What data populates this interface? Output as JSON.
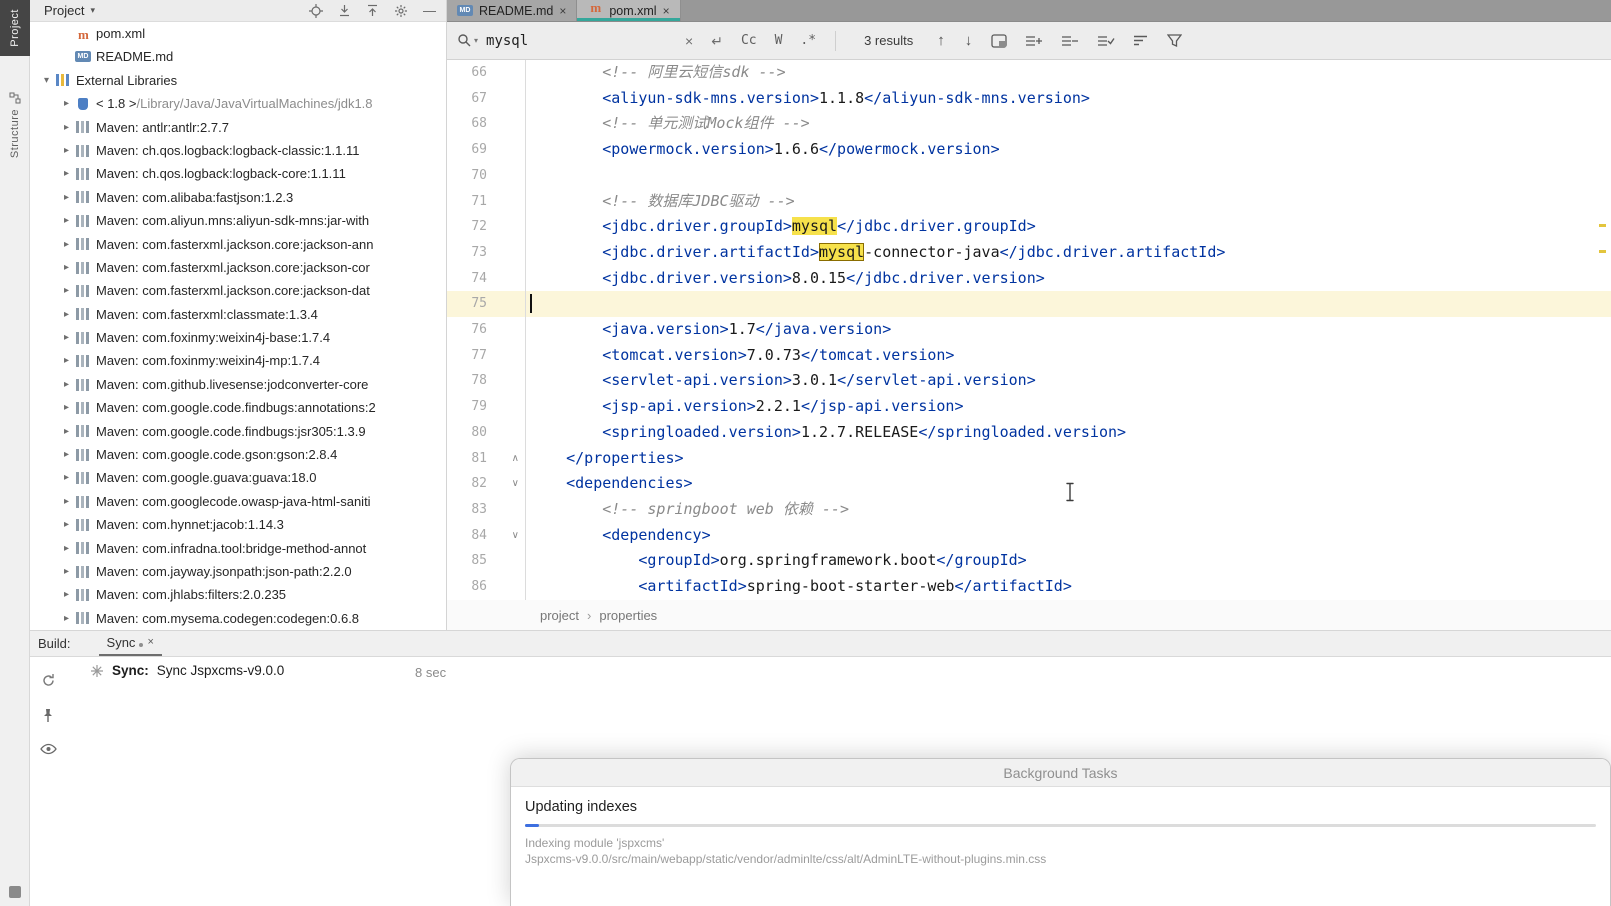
{
  "icons": {
    "close": "×",
    "chevron_down": "▾",
    "chevron_right": "▸",
    "arrow_up": "↑",
    "arrow_down": "↓",
    "enter_arrow": "↵",
    "breadcrumb_separator": "›",
    "minimize": "—",
    "fold_up": "∧",
    "fold_down": "∨"
  },
  "tool_stripe": {
    "project_label": "Project",
    "structure_label": "Structure"
  },
  "project_panel": {
    "title": "Project",
    "tree": [
      {
        "label": "pom.xml",
        "icon": "maven",
        "arrow": null,
        "indent": 1
      },
      {
        "label": "README.md",
        "icon": "md",
        "arrow": null,
        "indent": 1
      },
      {
        "label": "External Libraries",
        "icon": "libs",
        "arrow": "down",
        "indent": 0
      },
      {
        "label": "< 1.8 >",
        "sub": " /Library/Java/JavaVirtualMachines/jdk1.8",
        "icon": "jdk",
        "arrow": "right",
        "indent": 1
      },
      {
        "label": "Maven: antlr:antlr:2.7.7",
        "icon": "lib",
        "arrow": "right",
        "indent": 1
      },
      {
        "label": "Maven: ch.qos.logback:logback-classic:1.1.11",
        "icon": "lib",
        "arrow": "right",
        "indent": 1
      },
      {
        "label": "Maven: ch.qos.logback:logback-core:1.1.11",
        "icon": "lib",
        "arrow": "right",
        "indent": 1
      },
      {
        "label": "Maven: com.alibaba:fastjson:1.2.3",
        "icon": "lib",
        "arrow": "right",
        "indent": 1
      },
      {
        "label": "Maven: com.aliyun.mns:aliyun-sdk-mns:jar-with",
        "icon": "lib",
        "arrow": "right",
        "indent": 1
      },
      {
        "label": "Maven: com.fasterxml.jackson.core:jackson-ann",
        "icon": "lib",
        "arrow": "right",
        "indent": 1
      },
      {
        "label": "Maven: com.fasterxml.jackson.core:jackson-cor",
        "icon": "lib",
        "arrow": "right",
        "indent": 1
      },
      {
        "label": "Maven: com.fasterxml.jackson.core:jackson-dat",
        "icon": "lib",
        "arrow": "right",
        "indent": 1
      },
      {
        "label": "Maven: com.fasterxml:classmate:1.3.4",
        "icon": "lib",
        "arrow": "right",
        "indent": 1
      },
      {
        "label": "Maven: com.foxinmy:weixin4j-base:1.7.4",
        "icon": "lib",
        "arrow": "right",
        "indent": 1
      },
      {
        "label": "Maven: com.foxinmy:weixin4j-mp:1.7.4",
        "icon": "lib",
        "arrow": "right",
        "indent": 1
      },
      {
        "label": "Maven: com.github.livesense:jodconverter-core",
        "icon": "lib",
        "arrow": "right",
        "indent": 1
      },
      {
        "label": "Maven: com.google.code.findbugs:annotations:2",
        "icon": "lib",
        "arrow": "right",
        "indent": 1
      },
      {
        "label": "Maven: com.google.code.findbugs:jsr305:1.3.9",
        "icon": "lib",
        "arrow": "right",
        "indent": 1
      },
      {
        "label": "Maven: com.google.code.gson:gson:2.8.4",
        "icon": "lib",
        "arrow": "right",
        "indent": 1
      },
      {
        "label": "Maven: com.google.guava:guava:18.0",
        "icon": "lib",
        "arrow": "right",
        "indent": 1
      },
      {
        "label": "Maven: com.googlecode.owasp-java-html-saniti",
        "icon": "lib",
        "arrow": "right",
        "indent": 1
      },
      {
        "label": "Maven: com.hynnet:jacob:1.14.3",
        "icon": "lib",
        "arrow": "right",
        "indent": 1
      },
      {
        "label": "Maven: com.infradna.tool:bridge-method-annot",
        "icon": "lib",
        "arrow": "right",
        "indent": 1
      },
      {
        "label": "Maven: com.jayway.jsonpath:json-path:2.2.0",
        "icon": "lib",
        "arrow": "right",
        "indent": 1
      },
      {
        "label": "Maven: com.jhlabs:filters:2.0.235",
        "icon": "lib",
        "arrow": "right",
        "indent": 1
      },
      {
        "label": "Maven: com.mysema.codegen:codegen:0.6.8",
        "icon": "lib",
        "arrow": "right",
        "indent": 1
      }
    ]
  },
  "editor": {
    "tabs": [
      {
        "label": "README.md",
        "icon": "md"
      },
      {
        "label": "pom.xml",
        "icon": "maven"
      }
    ],
    "search": {
      "query": "mysql",
      "results_label": "3 results",
      "option_case": "Cc",
      "option_words": "W",
      "option_regex": ".*"
    },
    "breadcrumbs": [
      "project",
      "properties"
    ],
    "code": {
      "lines": [
        {
          "n": 66,
          "seg": [
            [
              "pl",
              "        "
            ],
            [
              "cm",
              "<!-- 阿里云短信sdk -->"
            ]
          ]
        },
        {
          "n": 67,
          "seg": [
            [
              "pl",
              "        "
            ],
            [
              "tg",
              "<aliyun-sdk-mns.version>"
            ],
            [
              "tx",
              "1.1.8"
            ],
            [
              "tg",
              "</aliyun-sdk-mns.version>"
            ]
          ]
        },
        {
          "n": 68,
          "seg": [
            [
              "pl",
              "        "
            ],
            [
              "cm",
              "<!-- 单元测试Mock组件 -->"
            ]
          ]
        },
        {
          "n": 69,
          "seg": [
            [
              "pl",
              "        "
            ],
            [
              "tg",
              "<powermock.version>"
            ],
            [
              "tx",
              "1.6.6"
            ],
            [
              "tg",
              "</powermock.version>"
            ]
          ]
        },
        {
          "n": 70,
          "seg": []
        },
        {
          "n": 71,
          "seg": [
            [
              "pl",
              "        "
            ],
            [
              "cm",
              "<!-- 数据库JDBC驱动 -->"
            ]
          ]
        },
        {
          "n": 72,
          "seg": [
            [
              "pl",
              "        "
            ],
            [
              "tg",
              "<jdbc.driver.groupId>"
            ],
            [
              "hl",
              "mysql"
            ],
            [
              "tg",
              "</jdbc.driver.groupId>"
            ]
          ]
        },
        {
          "n": 73,
          "seg": [
            [
              "pl",
              "        "
            ],
            [
              "tg",
              "<jdbc.driver.artifactId>"
            ],
            [
              "hc",
              "mysql"
            ],
            [
              "tx",
              "-connector-java"
            ],
            [
              "tg",
              "</jdbc.driver.artifactId>"
            ]
          ]
        },
        {
          "n": 74,
          "seg": [
            [
              "pl",
              "        "
            ],
            [
              "tg",
              "<jdbc.driver.version>"
            ],
            [
              "tx",
              "8.0.15"
            ],
            [
              "tg",
              "</jdbc.driver.version>"
            ]
          ]
        },
        {
          "n": 75,
          "cur": true,
          "caret": true,
          "seg": []
        },
        {
          "n": 76,
          "seg": [
            [
              "pl",
              "        "
            ],
            [
              "tg",
              "<java.version>"
            ],
            [
              "tx",
              "1.7"
            ],
            [
              "tg",
              "</java.version>"
            ]
          ]
        },
        {
          "n": 77,
          "seg": [
            [
              "pl",
              "        "
            ],
            [
              "tg",
              "<tomcat.version>"
            ],
            [
              "tx",
              "7.0.73"
            ],
            [
              "tg",
              "</tomcat.version>"
            ]
          ]
        },
        {
          "n": 78,
          "seg": [
            [
              "pl",
              "        "
            ],
            [
              "tg",
              "<servlet-api.version>"
            ],
            [
              "tx",
              "3.0.1"
            ],
            [
              "tg",
              "</servlet-api.version>"
            ]
          ]
        },
        {
          "n": 79,
          "seg": [
            [
              "pl",
              "        "
            ],
            [
              "tg",
              "<jsp-api.version>"
            ],
            [
              "tx",
              "2.2.1"
            ],
            [
              "tg",
              "</jsp-api.version>"
            ]
          ]
        },
        {
          "n": 80,
          "seg": [
            [
              "pl",
              "        "
            ],
            [
              "tg",
              "<springloaded.version>"
            ],
            [
              "tx",
              "1.2.7.RELEASE"
            ],
            [
              "tg",
              "</springloaded.version>"
            ]
          ]
        },
        {
          "n": 81,
          "fold": "up",
          "seg": [
            [
              "pl",
              "    "
            ],
            [
              "tg",
              "</properties>"
            ]
          ]
        },
        {
          "n": 82,
          "fold": "down",
          "seg": [
            [
              "pl",
              "    "
            ],
            [
              "tg",
              "<dependencies>"
            ]
          ]
        },
        {
          "n": 83,
          "seg": [
            [
              "pl",
              "        "
            ],
            [
              "cm",
              "<!-- springboot web 依赖 -->"
            ]
          ]
        },
        {
          "n": 84,
          "fold": "down",
          "seg": [
            [
              "pl",
              "        "
            ],
            [
              "tg",
              "<dependency>"
            ]
          ]
        },
        {
          "n": 85,
          "seg": [
            [
              "pl",
              "            "
            ],
            [
              "tg",
              "<groupId>"
            ],
            [
              "tx",
              "org.springframework.boot"
            ],
            [
              "tg",
              "</groupId>"
            ]
          ]
        },
        {
          "n": 86,
          "seg": [
            [
              "pl",
              "            "
            ],
            [
              "tg",
              "<artifactId>"
            ],
            [
              "tx",
              "spring-boot-starter-web"
            ],
            [
              "tg",
              "</artifactId>"
            ]
          ]
        }
      ]
    }
  },
  "build_panel": {
    "label": "Build:",
    "tab_label": "Sync",
    "message_prefix": "Sync:",
    "message": "Sync Jspxcms-v9.0.0",
    "duration": "8 sec"
  },
  "background_tasks": {
    "title": "Background Tasks",
    "task_title": "Updating indexes",
    "progress_percent": 1.3,
    "detail_line1": "Indexing module 'jspxcms'",
    "detail_line2": "Jspxcms-v9.0.0/src/main/webapp/static/vendor/adminlte/css/alt/AdminLTE-without-plugins.min.css"
  }
}
